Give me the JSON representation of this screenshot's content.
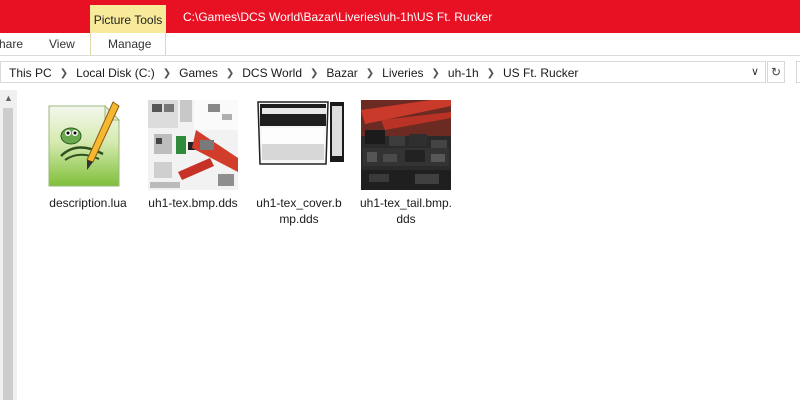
{
  "window": {
    "context_tab_group": "Picture Tools",
    "title": "C:\\Games\\DCS World\\Bazar\\Liveries\\uh-1h\\US Ft. Rucker"
  },
  "ribbon": {
    "tabs": [
      {
        "label": "hare"
      },
      {
        "label": "View"
      },
      {
        "label": "Manage"
      }
    ]
  },
  "address": {
    "crumbs": [
      "This PC",
      "Local Disk (C:)",
      "Games",
      "DCS World",
      "Bazar",
      "Liveries",
      "uh-1h",
      "US Ft. Rucker"
    ]
  },
  "files": [
    {
      "name": "description.lua",
      "icon": "notepad-plus-plus-icon"
    },
    {
      "name_line1": "uh1-tex.bmp.dds",
      "name_line2": "",
      "icon": "texture-thumbnail"
    },
    {
      "name_line1": "uh1-tex_cover.b",
      "name_line2": "mp.dds",
      "icon": "texture-thumbnail"
    },
    {
      "name_line1": "uh1-tex_tail.bmp.",
      "name_line2": "dds",
      "icon": "texture-thumbnail"
    }
  ],
  "colors": {
    "titlebar": "#e81123",
    "context_tab": "#f7ea9a"
  }
}
